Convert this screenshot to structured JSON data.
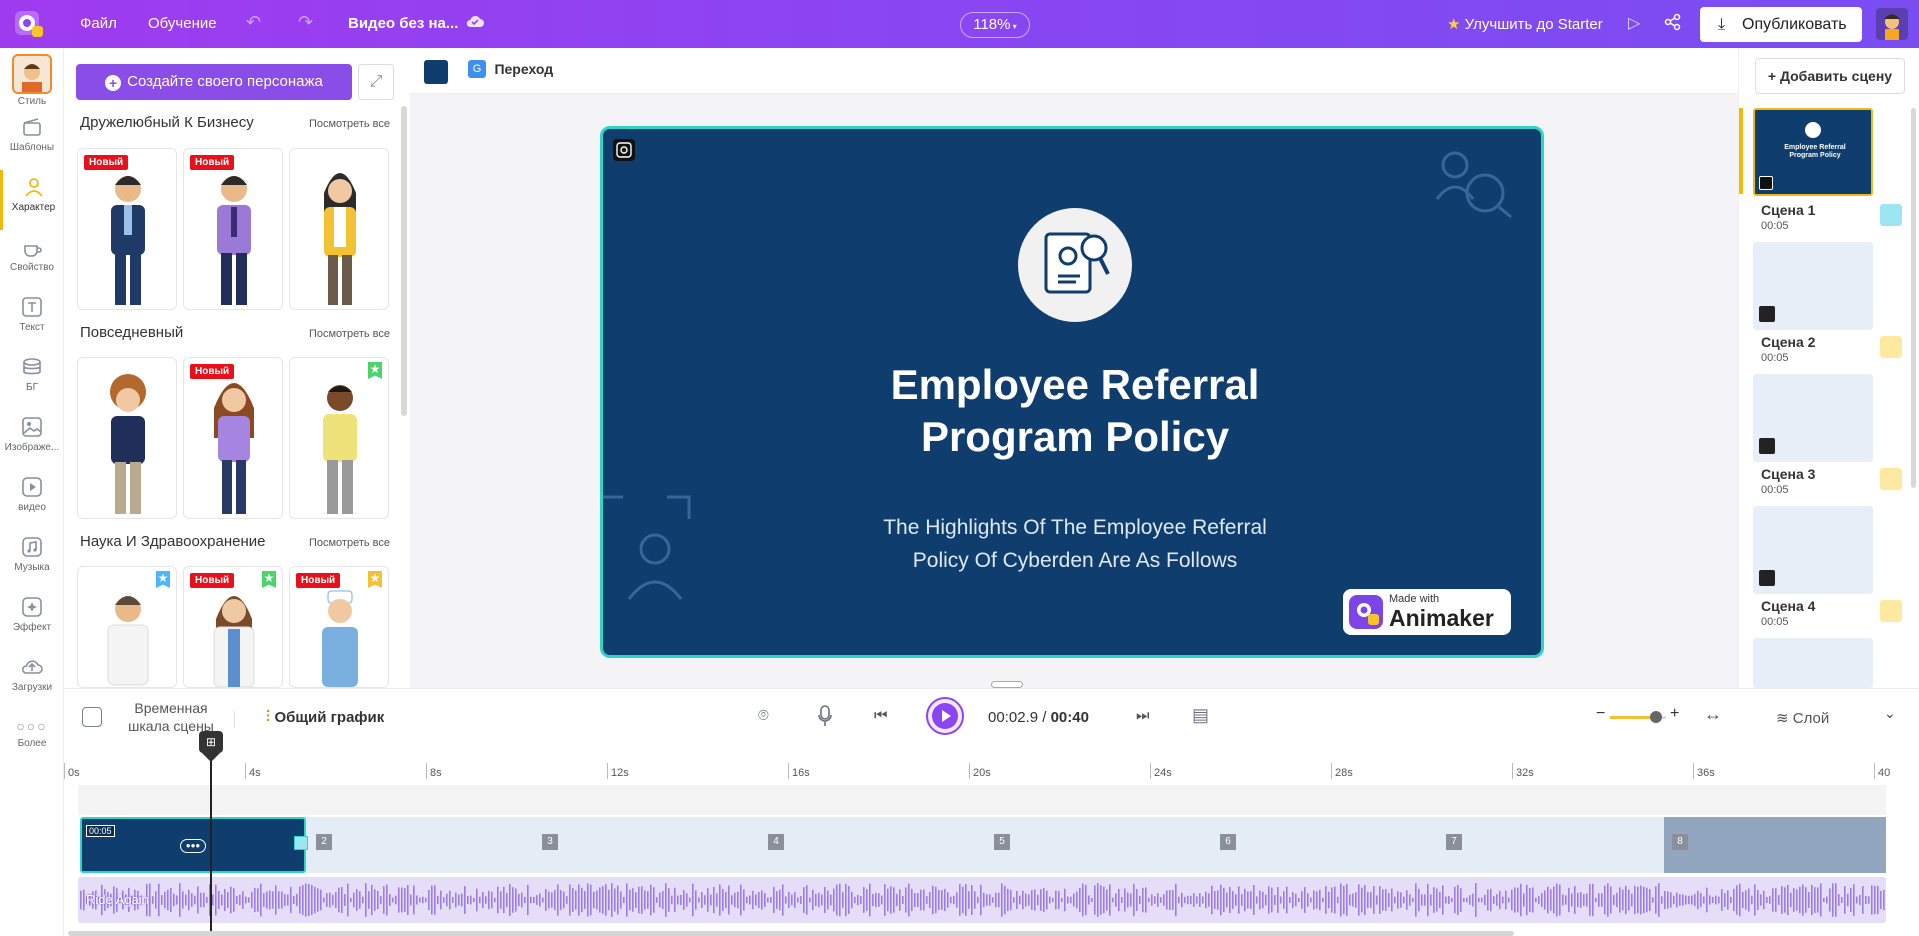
{
  "topbar": {
    "file": "Файл",
    "learning": "Обучение",
    "project_title": "Видео без на...",
    "zoom": "118%",
    "upgrade": "Улучшить до Starter",
    "publish": "Опубликовать"
  },
  "leftnav": [
    {
      "label": "Стиль",
      "icon": "style-avatar"
    },
    {
      "label": "Шаблоны",
      "icon": "templates-icon"
    },
    {
      "label": "Характер",
      "icon": "character-icon",
      "active": true
    },
    {
      "label": "Свойство",
      "icon": "property-icon"
    },
    {
      "label": "Текст",
      "icon": "text-icon"
    },
    {
      "label": "БГ",
      "icon": "bg-icon"
    },
    {
      "label": "Изображе...",
      "icon": "image-icon"
    },
    {
      "label": "видео",
      "icon": "video-icon"
    },
    {
      "label": "Музыка",
      "icon": "music-icon"
    },
    {
      "label": "Эффект",
      "icon": "effect-icon"
    },
    {
      "label": "Загрузки",
      "icon": "upload-icon"
    },
    {
      "label": "Более",
      "icon": "more-icon"
    }
  ],
  "panel": {
    "create_button": "Создайте своего персонажа",
    "sections": [
      {
        "title": "Дружелюбный К Бизнесу",
        "link": "Посмотреть все",
        "cards": [
          {
            "badge": "Новый",
            "star": ""
          },
          {
            "badge": "Новый",
            "star": ""
          },
          {
            "badge": "",
            "star": ""
          }
        ]
      },
      {
        "title": "Повседневный",
        "link": "Посмотреть все",
        "cards": [
          {
            "badge": "",
            "star": ""
          },
          {
            "badge": "Новый",
            "star": ""
          },
          {
            "badge": "",
            "star": "green"
          }
        ]
      },
      {
        "title": "Наука И Здравоохранение",
        "link": "Посмотреть все",
        "cards": [
          {
            "badge": "",
            "star": "blue"
          },
          {
            "badge": "Новый",
            "star": "green"
          },
          {
            "badge": "Новый",
            "star": "yellow"
          }
        ]
      }
    ]
  },
  "canvas": {
    "transition_label": "Переход",
    "swatch_color": "#0f3d6e",
    "slide_title": "Employee Referral\nProgram Policy",
    "slide_subtitle": "The Highlights Of The Employee Referral\nPolicy Of Cyberden Are As Follows",
    "watermark_small": "Made with",
    "watermark_brand": "Animaker"
  },
  "scenes_panel": {
    "add_button": "+ Добавить сцену",
    "scenes": [
      {
        "name": "Сцена 1",
        "duration": "00:05",
        "thumb_title": "Employee Referral Program Policy"
      },
      {
        "name": "Сцена 2",
        "duration": "00:05"
      },
      {
        "name": "Сцена 3",
        "duration": "00:05"
      },
      {
        "name": "Сцена 4",
        "duration": "00:05"
      }
    ]
  },
  "timeline": {
    "scene_timeline_label": "Временная шкала сцены",
    "general_schedule": "Общий график",
    "current_time": "00:02.9",
    "separator": " / ",
    "total_time": "00:40",
    "layer": "Слой",
    "ruler": [
      "0s",
      "4s",
      "8s",
      "12s",
      "16s",
      "20s",
      "24s",
      "28s",
      "32s",
      "36s",
      "40"
    ],
    "scene_block_duration": "00:05",
    "scene_numbers": [
      "2",
      "3",
      "4",
      "5",
      "6",
      "7",
      "8"
    ],
    "audio_label": "Ride Again"
  },
  "colors": {
    "accent": "#8b4de8",
    "slide_bg": "#0f3d6e",
    "selection": "#2fd4c9"
  }
}
